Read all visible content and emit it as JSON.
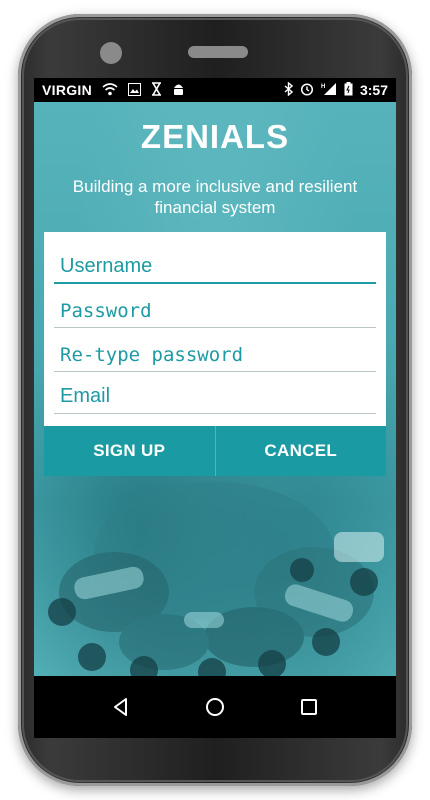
{
  "status_bar": {
    "carrier": "VIRGIN",
    "time": "3:57",
    "icons_left": [
      "wifi-signal-icon",
      "image-icon",
      "hourglass-icon",
      "android-icon"
    ],
    "icons_right": [
      "bluetooth-icon",
      "alarm-icon",
      "cell-signal-icon",
      "battery-icon"
    ]
  },
  "app": {
    "title": "ZENIALS",
    "tagline": "Building a more inclusive and resilient financial system"
  },
  "form": {
    "username_placeholder": "Username",
    "password_placeholder": "Password",
    "retype_password_placeholder": "Re-type password",
    "email_placeholder": "Email"
  },
  "buttons": {
    "sign_up": "SIGN UP",
    "cancel": "CANCEL"
  },
  "nav": {
    "back": "back-icon",
    "home": "home-icon",
    "recents": "recents-icon"
  },
  "colors": {
    "accent": "#1a9aa3",
    "background_tint": "#4aaab3"
  }
}
